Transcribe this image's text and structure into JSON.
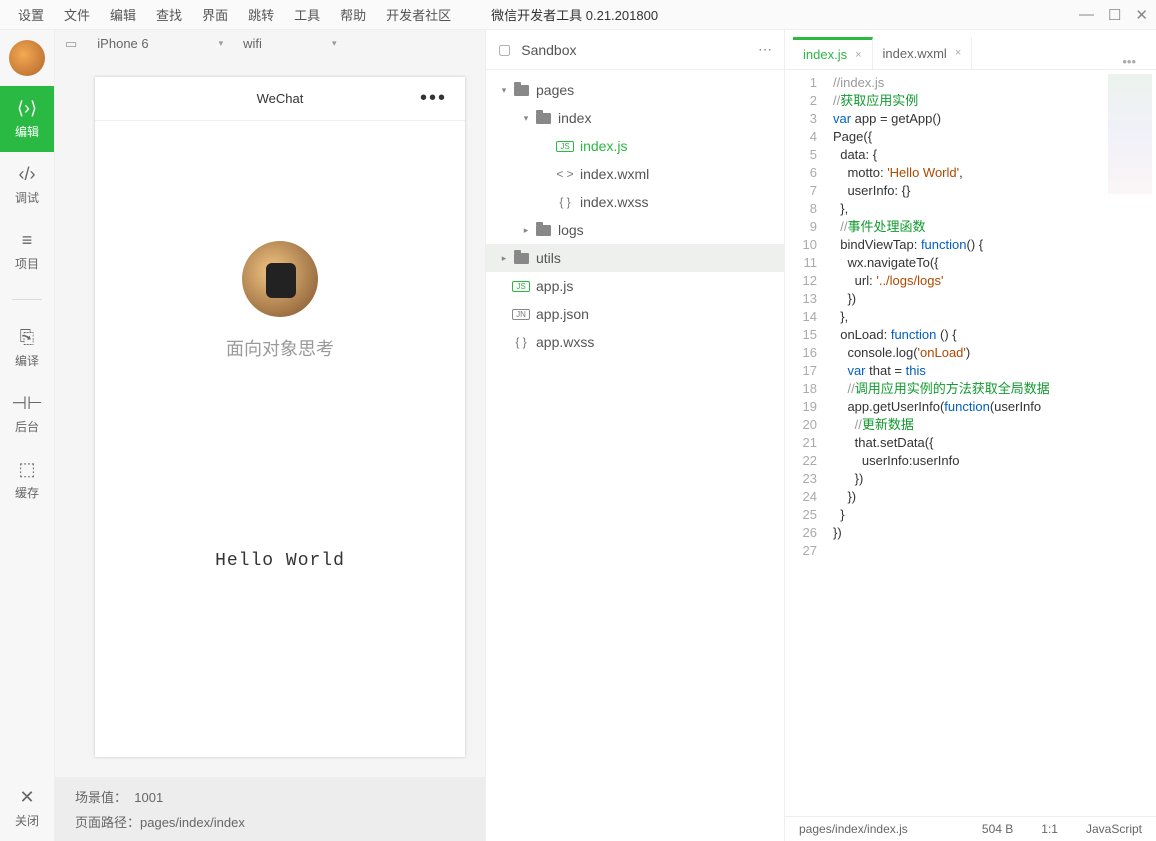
{
  "menu": [
    "设置",
    "文件",
    "编辑",
    "查找",
    "界面",
    "跳转",
    "工具",
    "帮助",
    "开发者社区"
  ],
  "app_title": "微信开发者工具 0.21.201800",
  "sidebar_nav": [
    {
      "label": "编辑"
    },
    {
      "label": "调试"
    },
    {
      "label": "项目"
    },
    {
      "label": "编译"
    },
    {
      "label": "后台"
    },
    {
      "label": "缓存"
    },
    {
      "label": "关闭"
    }
  ],
  "device_bar": {
    "device": "iPhone 6",
    "network": "wifi"
  },
  "phone": {
    "title": "WeChat",
    "username": "面向对象思考",
    "motto": "Hello World"
  },
  "preview_footer": {
    "scene_label": "场景值：",
    "scene_value": "1001",
    "path_label": "页面路径：",
    "path_value": "pages/index/index"
  },
  "tree": {
    "title": "Sandbox",
    "rows": [
      {
        "indent": 0,
        "type": "folder",
        "arrow": "▾",
        "label": "pages"
      },
      {
        "indent": 1,
        "type": "folder",
        "arrow": "▾",
        "label": "index"
      },
      {
        "indent": 2,
        "type": "js",
        "label": "index.js",
        "sel": true
      },
      {
        "indent": 2,
        "type": "wxml",
        "label": "index.wxml"
      },
      {
        "indent": 2,
        "type": "wxss",
        "label": "index.wxss"
      },
      {
        "indent": 1,
        "type": "folder",
        "arrow": "▸",
        "label": "logs"
      },
      {
        "indent": 0,
        "type": "folder",
        "arrow": "▸",
        "label": "utils",
        "hl": true
      },
      {
        "indent": 0,
        "type": "js",
        "label": "app.js"
      },
      {
        "indent": 0,
        "type": "json",
        "label": "app.json"
      },
      {
        "indent": 0,
        "type": "wxss",
        "label": "app.wxss"
      }
    ]
  },
  "tabs": [
    {
      "label": "index.js",
      "active": true
    },
    {
      "label": "index.wxml"
    }
  ],
  "code": {
    "lines": [
      [
        {
          "c": "c-cmt",
          "t": "//index.js"
        }
      ],
      [
        {
          "c": "c-cmt",
          "t": "//"
        },
        {
          "c": "c-cmt-zh",
          "t": "获取应用实例"
        }
      ],
      [
        {
          "c": "c-kw",
          "t": "var"
        },
        {
          "c": "c-ident",
          "t": " app = getApp()"
        }
      ],
      [
        {
          "c": "c-ident",
          "t": "Page({"
        }
      ],
      [
        {
          "c": "c-ident",
          "t": "  data: {"
        }
      ],
      [
        {
          "c": "c-ident",
          "t": "    motto: "
        },
        {
          "c": "c-str",
          "t": "'Hello World'"
        },
        {
          "c": "c-ident",
          "t": ","
        }
      ],
      [
        {
          "c": "c-ident",
          "t": "    userInfo: {}"
        }
      ],
      [
        {
          "c": "c-ident",
          "t": "  },"
        }
      ],
      [
        {
          "c": "c-ident",
          "t": "  "
        },
        {
          "c": "c-cmt",
          "t": "//"
        },
        {
          "c": "c-cmt-zh",
          "t": "事件处理函数"
        }
      ],
      [
        {
          "c": "c-ident",
          "t": "  bindViewTap: "
        },
        {
          "c": "c-kw",
          "t": "function"
        },
        {
          "c": "c-ident",
          "t": "() {"
        }
      ],
      [
        {
          "c": "c-ident",
          "t": "    wx.navigateTo({"
        }
      ],
      [
        {
          "c": "c-ident",
          "t": "      url: "
        },
        {
          "c": "c-str",
          "t": "'../logs/logs'"
        }
      ],
      [
        {
          "c": "c-ident",
          "t": "    })"
        }
      ],
      [
        {
          "c": "c-ident",
          "t": "  },"
        }
      ],
      [
        {
          "c": "c-ident",
          "t": "  onLoad: "
        },
        {
          "c": "c-kw",
          "t": "function"
        },
        {
          "c": "c-ident",
          "t": " () {"
        }
      ],
      [
        {
          "c": "c-ident",
          "t": "    console.log("
        },
        {
          "c": "c-str",
          "t": "'onLoad'"
        },
        {
          "c": "c-ident",
          "t": ")"
        }
      ],
      [
        {
          "c": "c-ident",
          "t": "    "
        },
        {
          "c": "c-kw",
          "t": "var"
        },
        {
          "c": "c-ident",
          "t": " that = "
        },
        {
          "c": "c-kw",
          "t": "this"
        }
      ],
      [
        {
          "c": "c-ident",
          "t": "    "
        },
        {
          "c": "c-cmt",
          "t": "//"
        },
        {
          "c": "c-cmt-zh",
          "t": "调用应用实例的方法获取全局数据"
        }
      ],
      [
        {
          "c": "c-ident",
          "t": "    app.getUserInfo("
        },
        {
          "c": "c-kw",
          "t": "function"
        },
        {
          "c": "c-ident",
          "t": "(userInfo"
        }
      ],
      [
        {
          "c": "c-ident",
          "t": "      "
        },
        {
          "c": "c-cmt",
          "t": "//"
        },
        {
          "c": "c-cmt-zh",
          "t": "更新数据"
        }
      ],
      [
        {
          "c": "c-ident",
          "t": "      that.setData({"
        }
      ],
      [
        {
          "c": "c-ident",
          "t": "        userInfo:userInfo"
        }
      ],
      [
        {
          "c": "c-ident",
          "t": "      })"
        }
      ],
      [
        {
          "c": "c-ident",
          "t": "    })"
        }
      ],
      [
        {
          "c": "c-ident",
          "t": "  }"
        }
      ],
      [
        {
          "c": "c-ident",
          "t": "})"
        }
      ],
      []
    ]
  },
  "status": {
    "path": "pages/index/index.js",
    "size": "504 B",
    "pos": "1:1",
    "lang": "JavaScript"
  }
}
